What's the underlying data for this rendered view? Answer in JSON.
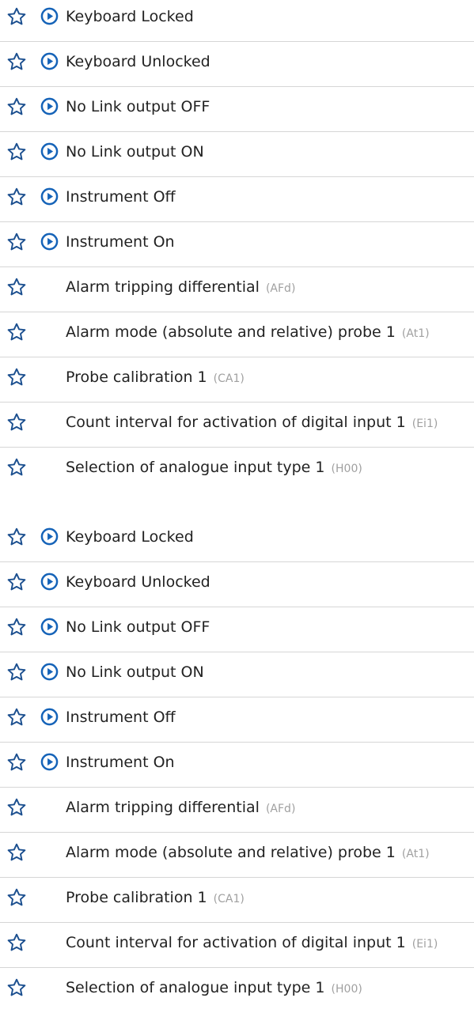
{
  "colors": {
    "star": "#1b4f8f",
    "play": "#1563b8",
    "divider": "#d6d6d6",
    "code": "#a0a0a0"
  },
  "icons": {
    "favorite": "star-outline-icon",
    "command": "play-circle-icon"
  },
  "groups": [
    {
      "commands": [
        {
          "label": "Keyboard Locked"
        },
        {
          "label": "Keyboard Unlocked"
        },
        {
          "label": "No Link output OFF"
        },
        {
          "label": "No Link output ON"
        },
        {
          "label": "Instrument Off"
        },
        {
          "label": "Instrument On"
        }
      ],
      "parameters": [
        {
          "label": "Alarm tripping differential",
          "code": "(AFd)"
        },
        {
          "label": "Alarm mode (absolute and relative) probe 1",
          "code": "(At1)"
        },
        {
          "label": "Probe calibration 1",
          "code": "(CA1)"
        },
        {
          "label": "Count interval for activation of digital input 1",
          "code": "(Ei1)"
        },
        {
          "label": "Selection of analogue input type 1",
          "code": "(H00)"
        }
      ]
    },
    {
      "commands": [
        {
          "label": "Keyboard Locked"
        },
        {
          "label": "Keyboard Unlocked"
        },
        {
          "label": "No Link output OFF"
        },
        {
          "label": "No Link output ON"
        },
        {
          "label": "Instrument Off"
        },
        {
          "label": "Instrument On"
        }
      ],
      "parameters": [
        {
          "label": "Alarm tripping differential",
          "code": "(AFd)"
        },
        {
          "label": "Alarm mode (absolute and relative) probe 1",
          "code": "(At1)"
        },
        {
          "label": "Probe calibration 1",
          "code": "(CA1)"
        },
        {
          "label": "Count interval for activation of digital input 1",
          "code": "(Ei1)"
        },
        {
          "label": "Selection of analogue input type 1",
          "code": "(H00)"
        }
      ]
    }
  ]
}
